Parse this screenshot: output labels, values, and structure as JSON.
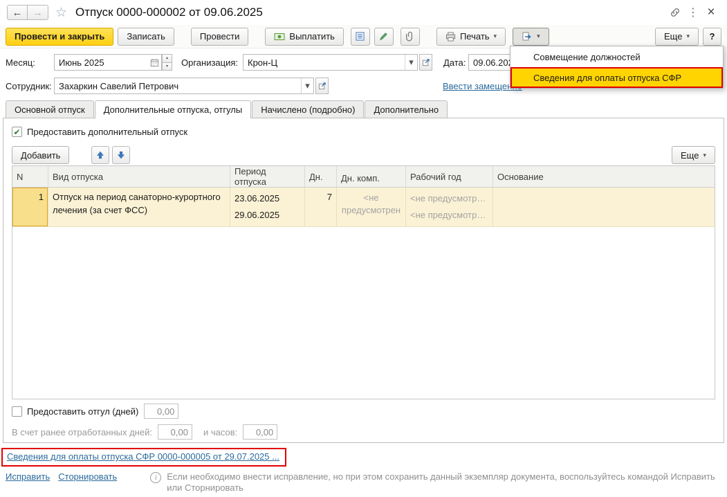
{
  "window": {
    "title": "Отпуск 0000-000002 от 09.06.2025"
  },
  "icons": {
    "back_arrow": "←",
    "forward_arrow": "→",
    "favorite_star": "☆",
    "menu_dots": "⋮",
    "close": "×",
    "caret_down": "▾",
    "spin_up": "▴",
    "spin_down": "▾",
    "checkmark": "✔",
    "info": "i"
  },
  "toolbar": {
    "post_and_close": "Провести и закрыть",
    "save": "Записать",
    "post": "Провести",
    "pay": "Выплатить",
    "print": "Печать",
    "more": "Еще",
    "help": "?"
  },
  "create_based_on_menu": {
    "items": [
      {
        "label": "Совмещение должностей",
        "highlighted": false
      },
      {
        "label": "Сведения для оплаты отпуска СФР",
        "highlighted": true
      }
    ]
  },
  "fields": {
    "month": {
      "label": "Месяц:",
      "value": "Июнь 2025"
    },
    "organization": {
      "label": "Организация:",
      "value": "Крон-Ц"
    },
    "date": {
      "label": "Дата:",
      "value": "09.06.2025"
    },
    "employee": {
      "label": "Сотрудник:",
      "value": "Захаркин Савелий Петрович"
    },
    "substitution_link": "Ввести замещение"
  },
  "tabs": [
    {
      "label": "Основной отпуск"
    },
    {
      "label": "Дополнительные отпуска, отгулы"
    },
    {
      "label": "Начислено (подробно)"
    },
    {
      "label": "Дополнительно"
    }
  ],
  "vacation_tab": {
    "provide_additional_checkbox": "Предоставить дополнительный отпуск",
    "add_button": "Добавить",
    "more_button": "Еще",
    "table": {
      "columns": [
        "N",
        "Вид отпуска",
        "Период отпуска",
        "Дн.",
        "Дн. комп.",
        "Рабочий год",
        "Основание"
      ],
      "row": {
        "n": "1",
        "vacation_kind": "Отпуск на период санаторно-курортного лечения (за счет ФСС)",
        "period_start": "23.06.2025",
        "period_end": "29.06.2025",
        "days": "7",
        "comp_days": "<не предусмотрен",
        "work_year_line1": "<не предусмотр…",
        "work_year_line2": "<не предусмотр…",
        "reason": ""
      }
    },
    "provide_otgul_checkbox": "Предоставить отгул (дней)",
    "otgul_days_value": "0,00",
    "earlier_days_label": "В счет ранее отработанных дней:",
    "earlier_days_value": "0,00",
    "hours_label": "и часов:",
    "hours_value": "0,00"
  },
  "footer": {
    "sfr_document_link": "Сведения для оплаты отпуска СФР 0000-000005 от 29.07.2025 ...",
    "fix_link": "Исправить",
    "reverse_link": "Сторнировать",
    "info_text": "Если необходимо внести исправление, но при этом сохранить данный экземпляр документа, воспользуйтесь командой Исправить или Сторнировать"
  }
}
